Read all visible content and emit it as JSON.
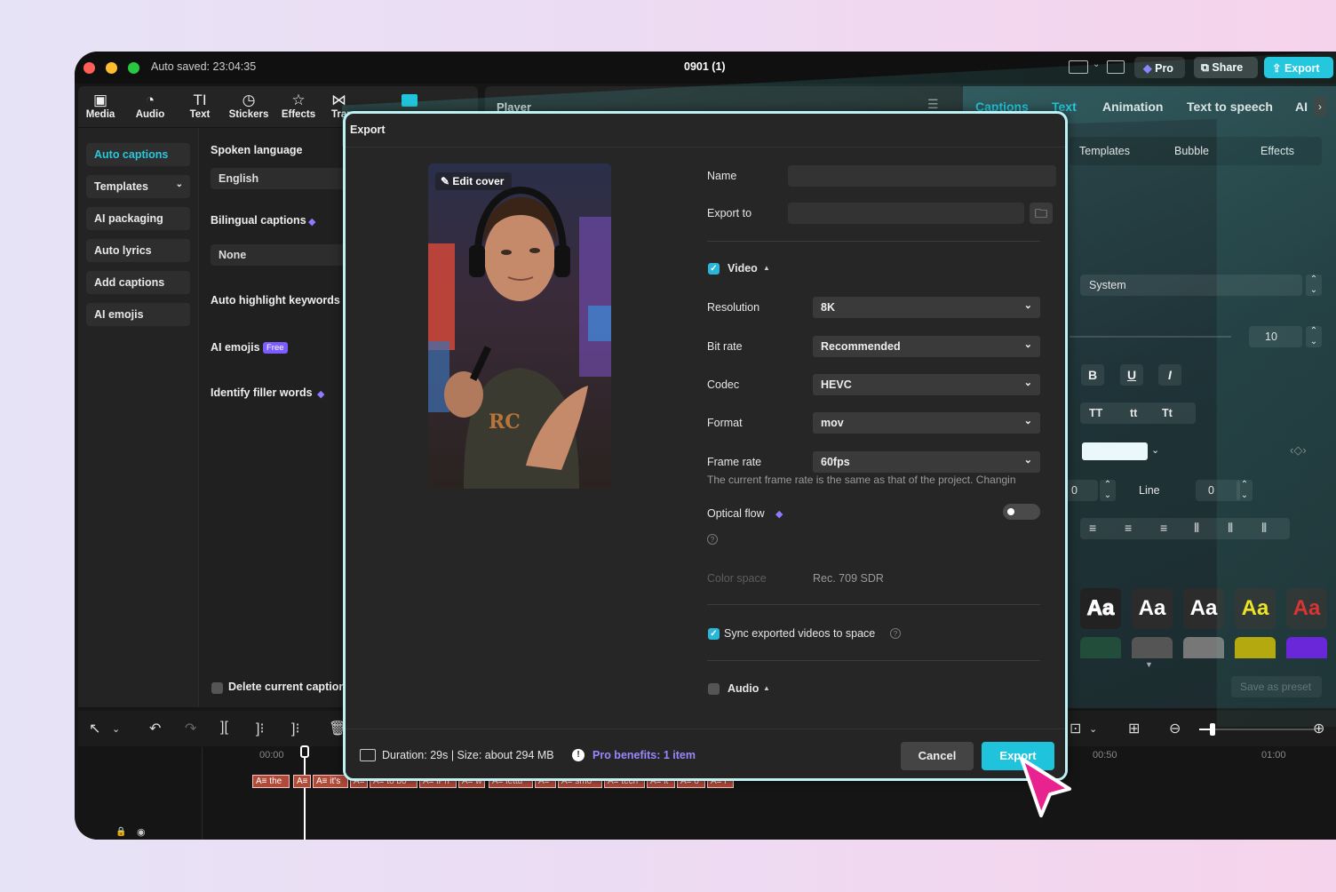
{
  "titlebar": {
    "autosave": "Auto saved: 23:04:35",
    "project": "0901 (1)",
    "pro": "Pro",
    "share": "Share",
    "export": "Export"
  },
  "toolbar": {
    "items": [
      {
        "label": "Media",
        "icon": "media-icon"
      },
      {
        "label": "Audio",
        "icon": "audio-icon"
      },
      {
        "label": "Text",
        "icon": "text-icon"
      },
      {
        "label": "Stickers",
        "icon": "stickers-icon"
      },
      {
        "label": "Effects",
        "icon": "effects-icon"
      },
      {
        "label": "Tran",
        "icon": "transitions-icon"
      }
    ]
  },
  "player": {
    "title": "Player"
  },
  "leftnav": {
    "items": [
      "Auto captions",
      "Templates",
      "AI packaging",
      "Auto lyrics",
      "Add captions",
      "AI emojis"
    ]
  },
  "captions_panel": {
    "spoken_language_label": "Spoken language",
    "spoken_language_value": "English",
    "bilingual_label": "Bilingual captions",
    "bilingual_value": "None",
    "auto_highlight": "Auto highlight keywords",
    "ai_emojis": "AI emojis",
    "free_badge": "Free",
    "filler_words": "Identify filler words",
    "delete_caption": "Delete current caption"
  },
  "right_panel": {
    "tabs": [
      "Captions",
      "Text",
      "Animation",
      "Text to speech",
      "AI"
    ],
    "subtabs": [
      "Templates",
      "Bubble",
      "Effects"
    ],
    "font": "System",
    "font_size": "10",
    "case_buttons": [
      "TT",
      "tt",
      "Tt"
    ],
    "line_label": "Line",
    "line_value": "0",
    "char_value": "0",
    "preset_samples": [
      "Aa",
      "Aa",
      "Aa",
      "Aa",
      "Aa"
    ],
    "save_preset": "Save as preset"
  },
  "timeline": {
    "time_start": "00:00",
    "time_mid": "00:50",
    "time_end": "01:00",
    "clips": [
      "the",
      "A≡",
      "it's",
      "A≡",
      "to bo",
      "iPh",
      "w",
      "lettu",
      "A≡",
      "smo",
      "tech",
      "it",
      "o",
      "r"
    ]
  },
  "export_modal": {
    "title": "Export",
    "edit_cover": "Edit cover",
    "name_label": "Name",
    "name_value": "",
    "export_to_label": "Export to",
    "export_to_value": "",
    "video_section": "Video",
    "resolution_label": "Resolution",
    "resolution_value": "8K",
    "bitrate_label": "Bit rate",
    "bitrate_value": "Recommended",
    "codec_label": "Codec",
    "codec_value": "HEVC",
    "format_label": "Format",
    "format_value": "mov",
    "framerate_label": "Frame rate",
    "framerate_value": "60fps",
    "framerate_note": "The current frame rate is the same as that of the project. Changin",
    "optical_flow_label": "Optical flow",
    "color_space_label": "Color space",
    "color_space_value": "Rec. 709 SDR",
    "sync_label": "Sync exported videos to space",
    "audio_section": "Audio",
    "footer_info": "Duration: 29s | Size: about 294 MB",
    "pro_benefits": "Pro benefits: 1 item",
    "cancel": "Cancel",
    "export": "Export"
  },
  "colors": {
    "accent": "#1fc4dc",
    "pink_cursor": "#e8228f",
    "pro_purple": "#8e7bff"
  }
}
